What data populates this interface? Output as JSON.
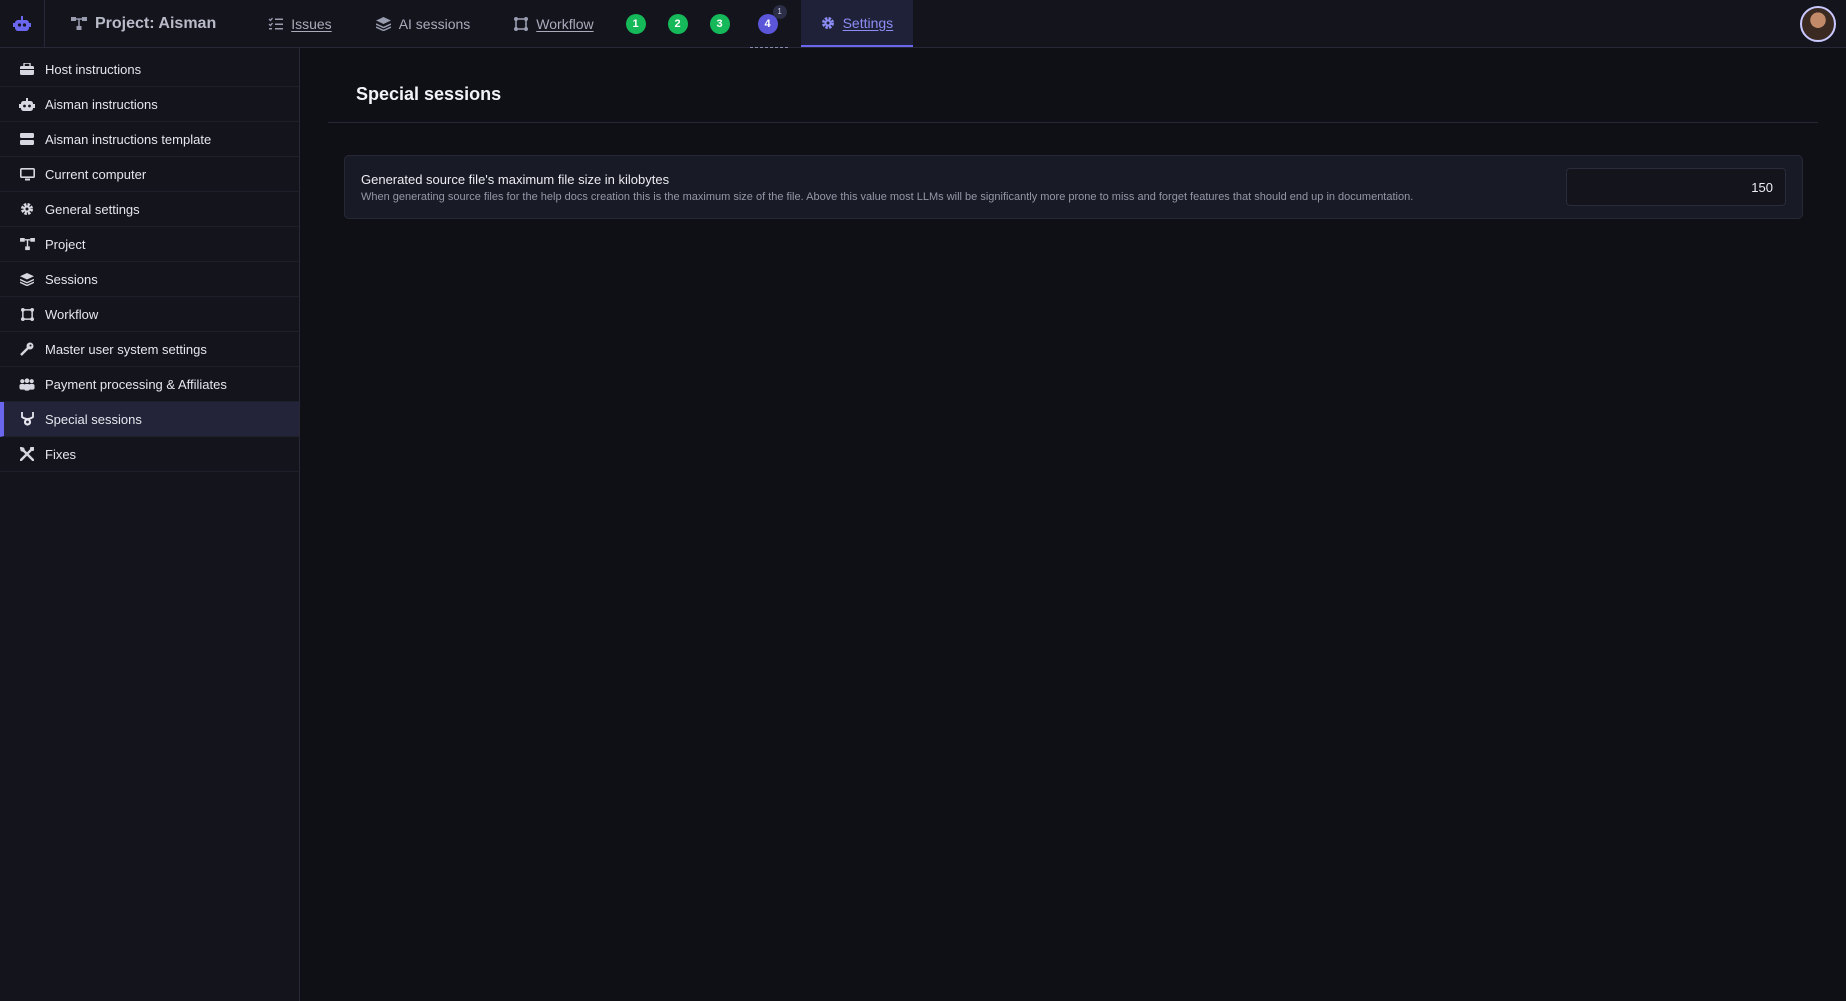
{
  "nav": {
    "project": "Project: Aisman",
    "issues": "Issues",
    "ai_sessions": "AI sessions",
    "workflow": "Workflow",
    "badges": [
      "1",
      "2",
      "3",
      "4"
    ],
    "badge4_count": "1",
    "settings": "Settings"
  },
  "sidebar": {
    "items": [
      {
        "label": "Host instructions",
        "icon": "server-icon"
      },
      {
        "label": "Aisman instructions",
        "icon": "robot-icon"
      },
      {
        "label": "Aisman instructions template",
        "icon": "database-icon"
      },
      {
        "label": "Current computer",
        "icon": "monitor-icon"
      },
      {
        "label": "General settings",
        "icon": "gear-icon"
      },
      {
        "label": "Project",
        "icon": "project-icon"
      },
      {
        "label": "Sessions",
        "icon": "layers-icon"
      },
      {
        "label": "Workflow",
        "icon": "workflow-icon"
      },
      {
        "label": "Master user system settings",
        "icon": "key-icon"
      },
      {
        "label": "Payment processing & Affiliates",
        "icon": "users-icon"
      },
      {
        "label": "Special sessions",
        "icon": "special-icon"
      },
      {
        "label": "Fixes",
        "icon": "tools-icon"
      }
    ],
    "active_index": 10
  },
  "main": {
    "title": "Special sessions",
    "setting": {
      "label": "Generated source file's maximum file size in kilobytes",
      "description": "When generating source files for the help docs creation this is the maximum size of the file. Above this value most LLMs will be significantly more prone to miss and forget features that should end up in documentation.",
      "value": "150"
    }
  },
  "colors": {
    "accent": "#6b66ee",
    "badge_green": "#16b95a",
    "background": "#0f1016"
  }
}
